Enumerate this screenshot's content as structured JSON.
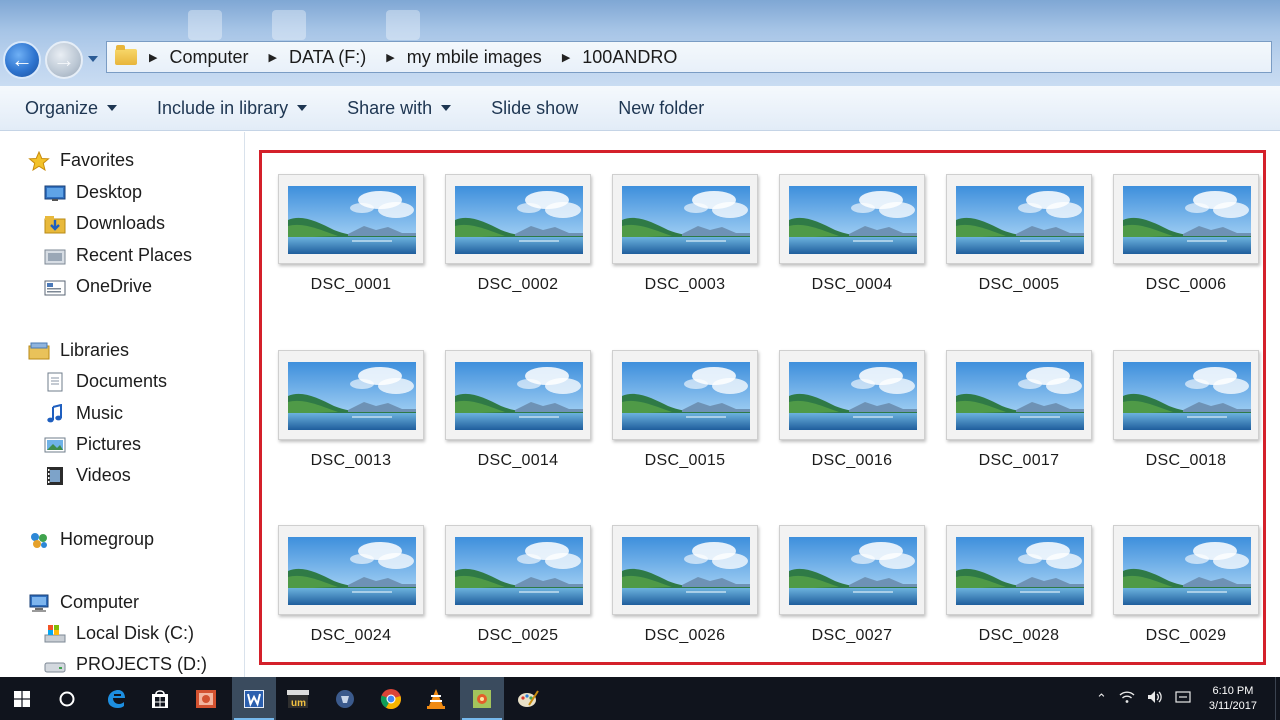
{
  "window": {
    "nav_back": "back",
    "nav_forward": "forward"
  },
  "address_bar": {
    "crumbs": [
      "Computer",
      "DATA (F:)",
      "my mbile images",
      "100ANDRO"
    ]
  },
  "toolbar": {
    "organize": "Organize",
    "include_in_library": "Include in library",
    "share_with": "Share with",
    "slide_show": "Slide show",
    "new_folder": "New folder"
  },
  "nav_pane": {
    "favorites": {
      "label": "Favorites",
      "items": [
        "Desktop",
        "Downloads",
        "Recent Places",
        "OneDrive"
      ]
    },
    "libraries": {
      "label": "Libraries",
      "items": [
        "Documents",
        "Music",
        "Pictures",
        "Videos"
      ]
    },
    "homegroup": "Homegroup",
    "computer": {
      "label": "Computer",
      "items": [
        "Local Disk (C:)",
        "PROJECTS (D:)"
      ]
    }
  },
  "files": [
    "DSC_0001",
    "DSC_0002",
    "DSC_0003",
    "DSC_0004",
    "DSC_0005",
    "DSC_0006",
    "DSC_0013",
    "DSC_0014",
    "DSC_0015",
    "DSC_0016",
    "DSC_0017",
    "DSC_0018",
    "DSC_0024",
    "DSC_0025",
    "DSC_0026",
    "DSC_0027",
    "DSC_0028",
    "DSC_0029"
  ],
  "highlight_color": "#d4202a",
  "taskbar": {
    "apps": [
      "start-icon",
      "cortana-icon",
      "edge-icon",
      "store-icon",
      "powerpoint-icon",
      "word-icon",
      "movie-maker-icon",
      "media-icon",
      "chrome-icon",
      "vlc-icon",
      "paint-app-icon",
      "paint-icon"
    ],
    "time": "6:10 PM",
    "date": "3/11/2017"
  }
}
